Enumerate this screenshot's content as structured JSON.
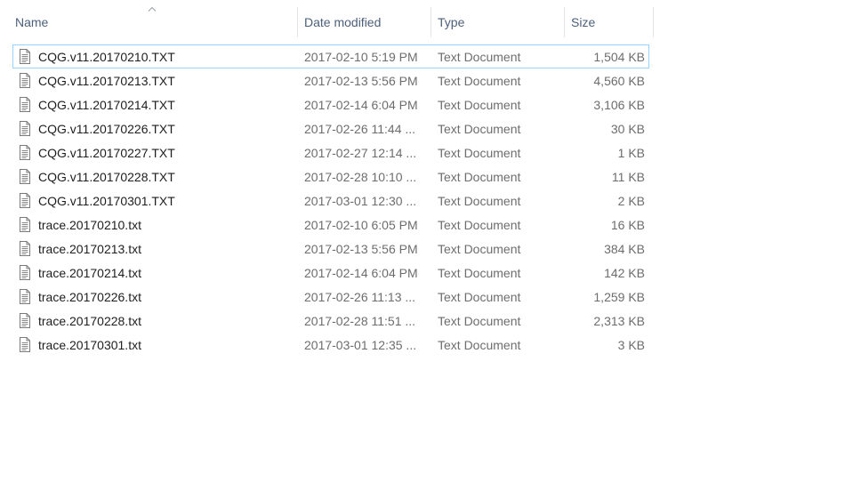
{
  "columns": {
    "name": "Name",
    "date": "Date modified",
    "type": "Type",
    "size": "Size",
    "sort_icon": "chevron-up-icon"
  },
  "colors": {
    "header_text": "#4c607a",
    "focus_border": "#99d1ff",
    "secondary_text": "#6d6d6d"
  },
  "files": [
    {
      "name": "CQG.v11.20170210.TXT",
      "date": "2017-02-10 5:19 PM",
      "type": "Text Document",
      "size": "1,504 KB",
      "icon": "text-document-icon",
      "focused": true
    },
    {
      "name": "CQG.v11.20170213.TXT",
      "date": "2017-02-13 5:56 PM",
      "type": "Text Document",
      "size": "4,560 KB",
      "icon": "text-document-icon"
    },
    {
      "name": "CQG.v11.20170214.TXT",
      "date": "2017-02-14 6:04 PM",
      "type": "Text Document",
      "size": "3,106 KB",
      "icon": "text-document-icon"
    },
    {
      "name": "CQG.v11.20170226.TXT",
      "date": "2017-02-26 11:44 ...",
      "type": "Text Document",
      "size": "30 KB",
      "icon": "text-document-icon"
    },
    {
      "name": "CQG.v11.20170227.TXT",
      "date": "2017-02-27 12:14 ...",
      "type": "Text Document",
      "size": "1 KB",
      "icon": "text-document-icon"
    },
    {
      "name": "CQG.v11.20170228.TXT",
      "date": "2017-02-28 10:10 ...",
      "type": "Text Document",
      "size": "11 KB",
      "icon": "text-document-icon"
    },
    {
      "name": "CQG.v11.20170301.TXT",
      "date": "2017-03-01 12:30 ...",
      "type": "Text Document",
      "size": "2 KB",
      "icon": "text-document-icon"
    },
    {
      "name": "trace.20170210.txt",
      "date": "2017-02-10 6:05 PM",
      "type": "Text Document",
      "size": "16 KB",
      "icon": "text-document-icon"
    },
    {
      "name": "trace.20170213.txt",
      "date": "2017-02-13 5:56 PM",
      "type": "Text Document",
      "size": "384 KB",
      "icon": "text-document-icon"
    },
    {
      "name": "trace.20170214.txt",
      "date": "2017-02-14 6:04 PM",
      "type": "Text Document",
      "size": "142 KB",
      "icon": "text-document-icon"
    },
    {
      "name": "trace.20170226.txt",
      "date": "2017-02-26 11:13 ...",
      "type": "Text Document",
      "size": "1,259 KB",
      "icon": "text-document-icon"
    },
    {
      "name": "trace.20170228.txt",
      "date": "2017-02-28 11:51 ...",
      "type": "Text Document",
      "size": "2,313 KB",
      "icon": "text-document-icon"
    },
    {
      "name": "trace.20170301.txt",
      "date": "2017-03-01 12:35 ...",
      "type": "Text Document",
      "size": "3 KB",
      "icon": "text-document-icon"
    }
  ]
}
